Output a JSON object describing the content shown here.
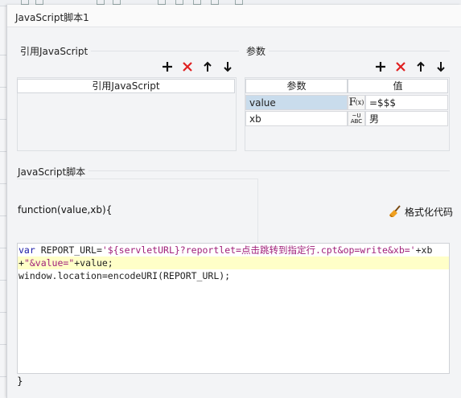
{
  "dialog": {
    "title": "JavaScript脚本1"
  },
  "ref_section": {
    "label": "引用JavaScript",
    "column_header": "引用JavaScript"
  },
  "params_section": {
    "label": "参数",
    "columns": [
      "参数",
      "值"
    ],
    "rows": [
      {
        "name": "value",
        "type_icon": "formula-icon",
        "type_glyph": "F(x)",
        "value": "=$$$"
      },
      {
        "name": "xb",
        "type_icon": "text-type-icon",
        "type_glyph": "ABC",
        "value": "男"
      }
    ]
  },
  "script_section": {
    "label": "JavaScript脚本",
    "function_header": "function(value,xb){",
    "format_button": "格式化代码",
    "closing": "}",
    "code": {
      "line1_kw": "var",
      "line1_a": " REPORT_URL=",
      "line1_str": "'${servletURL}?reportlet=点击跳转到指定行.cpt&op=write&xb='",
      "line1_b": "+xb",
      "line2_a": "+",
      "line2_str": "\"&value=\"",
      "line2_b": "+value;",
      "line3": "window.location=encodeURI(REPORT_URL);"
    }
  },
  "colors": {
    "delete": "#e02020",
    "selection": "#c9dcec",
    "highlight": "#ffffc8",
    "keyword": "#1a1aa6",
    "string": "#a0207a"
  }
}
